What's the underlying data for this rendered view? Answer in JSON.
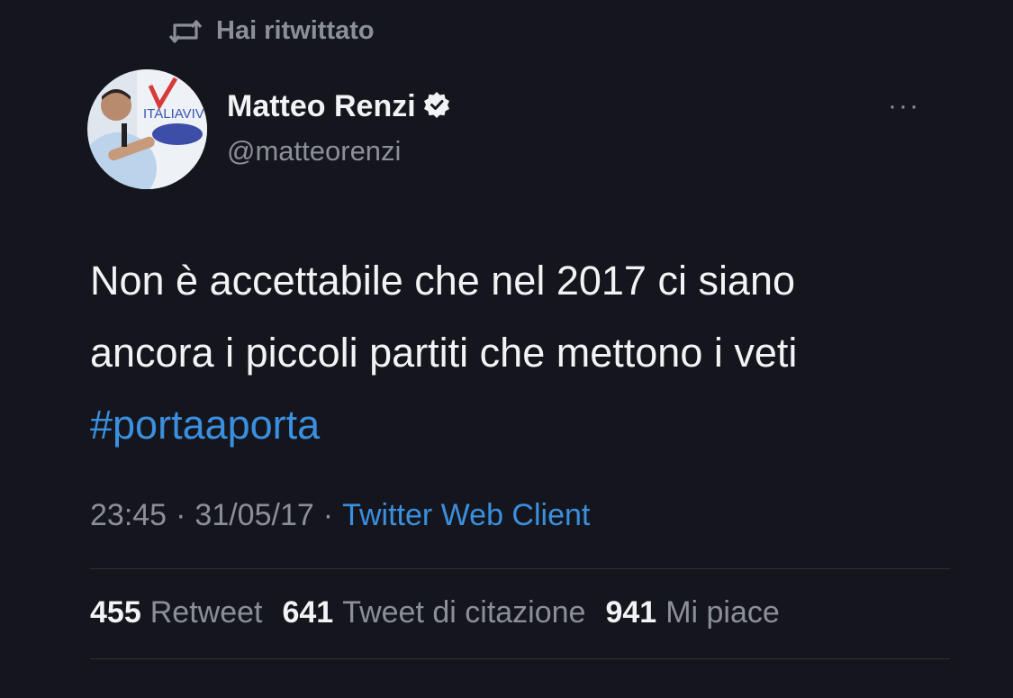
{
  "retweet_notice": {
    "icon": "retweet-icon",
    "label": "Hai ritwittato"
  },
  "author": {
    "avatar_icon": "avatar",
    "avatar_logo_text": "ITALIAVIV",
    "name": "Matteo Renzi",
    "verified_icon": "verified-badge-icon",
    "handle": "@matteorenzi"
  },
  "menu": {
    "icon": "more-options-icon",
    "label": "···"
  },
  "tweet": {
    "text": "Non è accettabile che nel 2017 ci siano\nancora i piccoli partiti che mettono i veti",
    "hashtag": "#portaaporta"
  },
  "meta": {
    "time": "23:45",
    "separator1": "·",
    "date": "31/05/17",
    "separator2": "·",
    "source": "Twitter Web Client"
  },
  "stats": [
    {
      "value": "455",
      "label": "Retweet"
    },
    {
      "value": "641",
      "label": "Tweet di citazione"
    },
    {
      "value": "941",
      "label": "Mi piace"
    }
  ],
  "colors": {
    "background": "#15161d",
    "text": "#f2f3f5",
    "secondary": "#8b8f96",
    "link": "#3b8fdf",
    "divider": "#2f3238"
  }
}
